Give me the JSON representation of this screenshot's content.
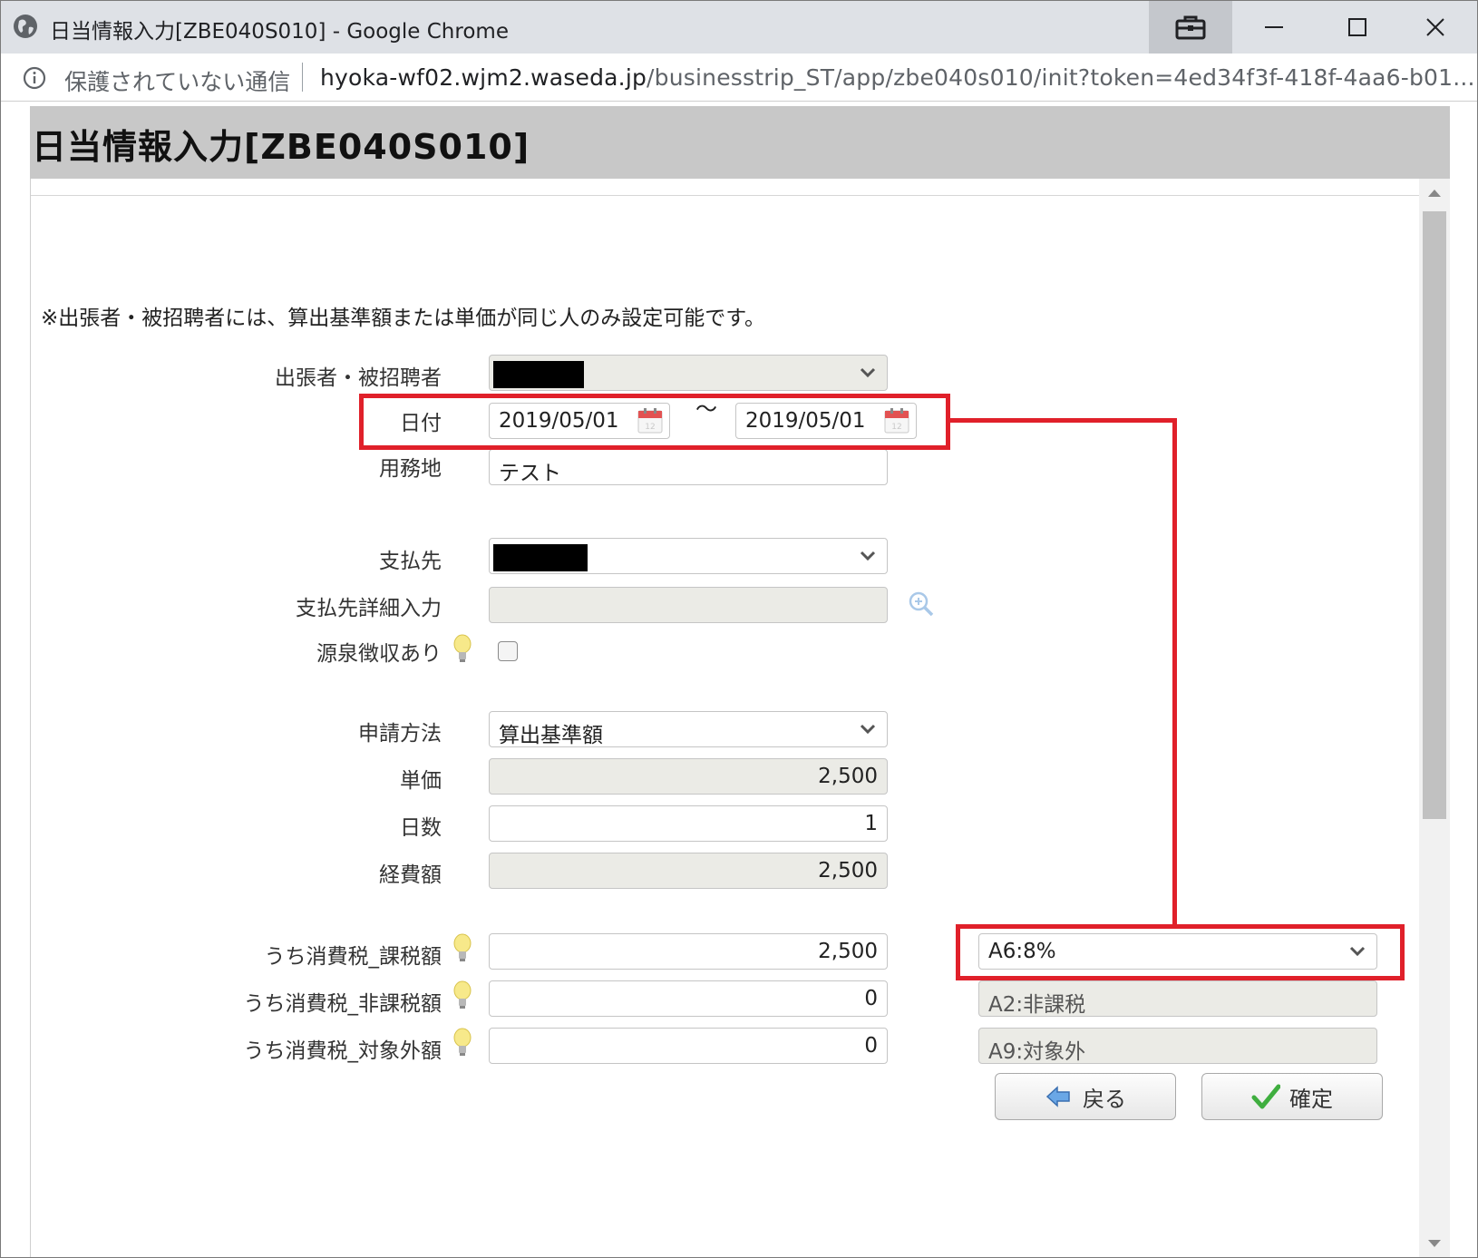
{
  "window": {
    "title": "日当情報入力[ZBE040S010] - Google Chrome"
  },
  "address": {
    "security_label": "保護されていない通信",
    "url_host": "hyoka-wf02.wjm2.waseda.jp",
    "url_path": "/businesstrip_ST/app/zbe040s010/init?token=4ed34f3f-418f-4aa6-b01..."
  },
  "page": {
    "title": "日当情報入力[ZBE040S010]",
    "note": "※出張者・被招聘者には、算出基準額または単価が同じ人のみ設定可能です。"
  },
  "form": {
    "traveler_label": "出張者・被招聘者",
    "date_label": "日付",
    "date_from": "2019/05/01",
    "date_separator": "～",
    "date_to": "2019/05/01",
    "destination_label": "用務地",
    "destination_value": "テスト",
    "payee_label": "支払先",
    "payee_detail_label": "支払先詳細入力",
    "withholding_label": "源泉徴収あり",
    "withholding_checked": false,
    "method_label": "申請方法",
    "method_value": "算出基準額",
    "unit_price_label": "単価",
    "unit_price_value": "2,500",
    "days_label": "日数",
    "days_value": "1",
    "expense_label": "経費額",
    "expense_value": "2,500",
    "tax_taxable_label": "うち消費税_課税額",
    "tax_taxable_value": "2,500",
    "tax_taxable_code": "A6:8%",
    "tax_nontaxable_label": "うち消費税_非課税額",
    "tax_nontaxable_value": "0",
    "tax_nontaxable_code": "A2:非課税",
    "tax_exempt_label": "うち消費税_対象外額",
    "tax_exempt_value": "0",
    "tax_exempt_code": "A9:対象外"
  },
  "buttons": {
    "back": "戻る",
    "confirm": "確定"
  },
  "colors": {
    "annotation": "#e0202a",
    "header_bg": "#c8c8c8",
    "readonly_bg": "#ebebe6"
  }
}
